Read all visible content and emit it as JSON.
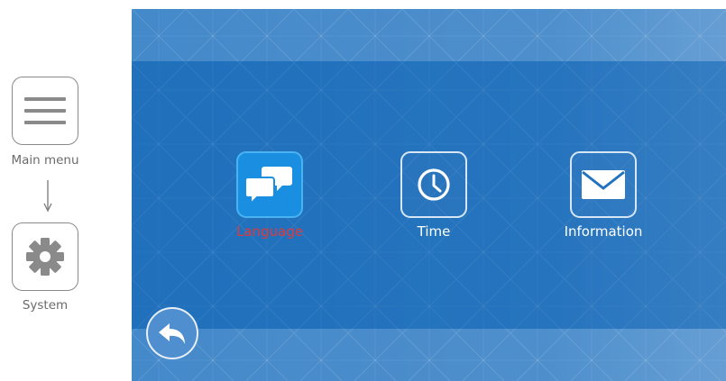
{
  "breadcrumb": {
    "main_menu_label": "Main menu",
    "system_label": "System"
  },
  "menu": {
    "items": [
      {
        "label": "Language",
        "icon": "chat-bubbles-icon",
        "selected": true
      },
      {
        "label": "Time",
        "icon": "clock-icon",
        "selected": false
      },
      {
        "label": "Information",
        "icon": "envelope-icon",
        "selected": false
      }
    ]
  },
  "colors": {
    "screen_background": "#2173c0",
    "selected_label": "#e0393b",
    "selected_tile": "#1a8ee0",
    "tile_border": "#d6e6f5",
    "breadcrumb_text": "#6b6b6b"
  },
  "icons": {
    "back": "back-arrow-icon",
    "main_menu": "hamburger-menu-icon",
    "system": "gear-icon",
    "flow_arrow": "down-arrow-icon"
  }
}
